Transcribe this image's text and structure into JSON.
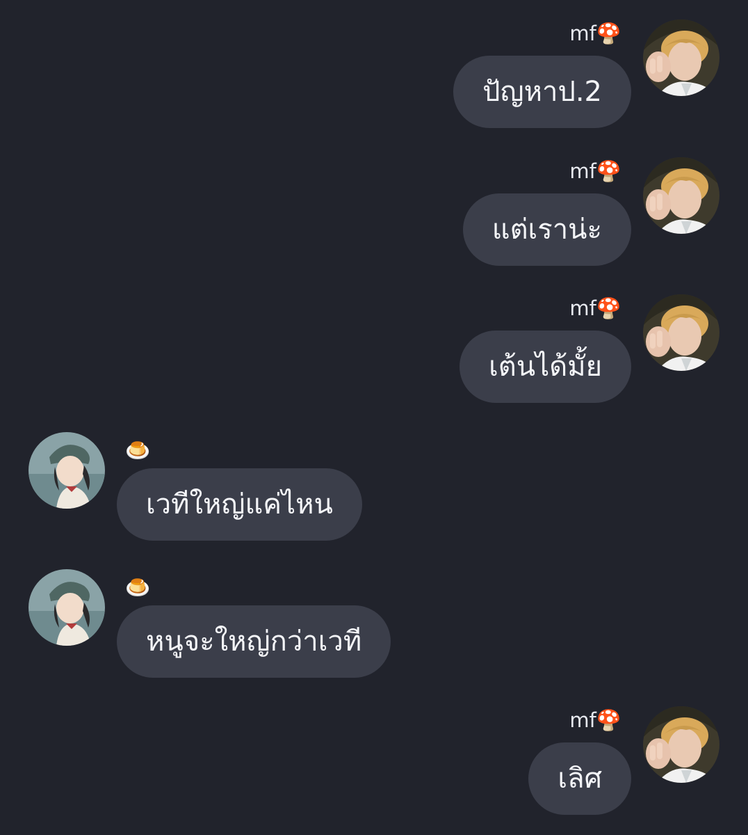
{
  "messages": [
    {
      "side": "out",
      "sender_name": "mf",
      "sender_emoji": "🍄",
      "text": "ปัญหาป.2",
      "avatar": "blond-selfie-avatar"
    },
    {
      "side": "out",
      "sender_name": "mf",
      "sender_emoji": "🍄",
      "text": "แต่เราน่ะ",
      "avatar": "blond-selfie-avatar"
    },
    {
      "side": "out",
      "sender_name": "mf",
      "sender_emoji": "🍄",
      "text": "เต้นได้มั้ย",
      "avatar": "blond-selfie-avatar"
    },
    {
      "side": "in",
      "sender_name": "",
      "sender_emoji": "🍮",
      "text": "เวทีใหญ่แค่ไหน",
      "avatar": "child-hat-avatar"
    },
    {
      "side": "in",
      "sender_name": "",
      "sender_emoji": "🍮",
      "text": "หนูจะใหญ่กว่าเวที",
      "avatar": "child-hat-avatar"
    },
    {
      "side": "out",
      "sender_name": "mf",
      "sender_emoji": "🍄",
      "text": "เลิศ",
      "avatar": "blond-selfie-avatar"
    }
  ],
  "colors": {
    "background": "#21232c",
    "bubble": "#3b3e4a",
    "text": "#f4f5f8"
  }
}
